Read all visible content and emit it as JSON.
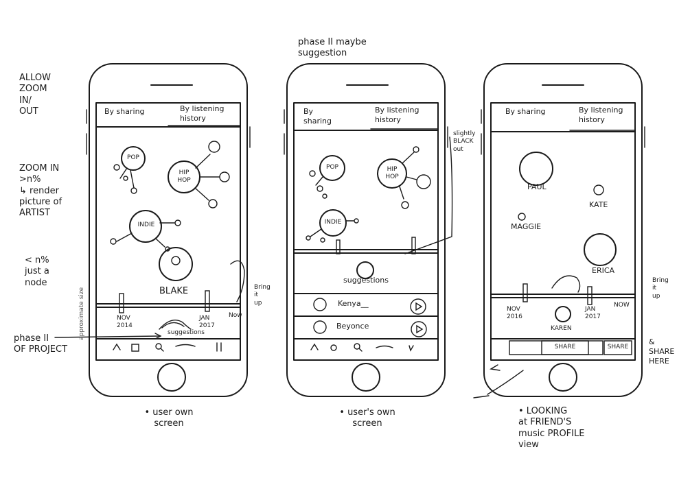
{
  "left_notes": {
    "zoom": "ALLOW\nZOOM\nIN/\nOUT",
    "zoom_in": "ZOOM IN\n>n%\n↳ render\npicture of\nARTIST",
    "zoom_out": "< n%\njust a\nnode",
    "phase2": "phase II\nOF PROJECT"
  },
  "top_note": "phase II maybe\nsuggestion",
  "approx_size": "approximate size",
  "phone1": {
    "tab_sharing": "By sharing",
    "tab_history": "By listening\nhistory",
    "nodes": [
      "POP",
      "HIP\nHOP",
      "INDIE"
    ],
    "artist_name": "BLAKE",
    "date_start": "NOV\n2014",
    "date_mid": "JAN\n2017",
    "date_end": "Now",
    "suggestions": "suggestions",
    "bring_up": "Bring\nit\nup",
    "caption": "• user own\nscreen"
  },
  "phone2": {
    "tab_sharing": "By\nsharing",
    "tab_history": "By listening\nhistory",
    "nodes": [
      "POP",
      "HIP\nHOP",
      "INDIE"
    ],
    "suggestions": "suggestions",
    "list": [
      "Kenya__",
      "Beyonce"
    ],
    "side_note": "slightly\nBLACK\nout",
    "caption": "• user's own\nscreen"
  },
  "phone3": {
    "tab_sharing": "By sharing",
    "tab_history": "By listening\nhistory",
    "friends": [
      "PAUL",
      "KATE",
      "MAGGIE",
      "ERICA"
    ],
    "date_start": "NOV\n2016",
    "date_mid": "JAN\n2017",
    "date_end": "NOW",
    "person": "KAREN",
    "share_btn": "SHARE",
    "share_btn2": "SHARE",
    "bring_up": "Bring\nit\nup",
    "share_here": "&\nSHARE\nHERE",
    "caption": "• LOOKING\nat FRIEND'S\nmusic PROFILE\nview"
  }
}
